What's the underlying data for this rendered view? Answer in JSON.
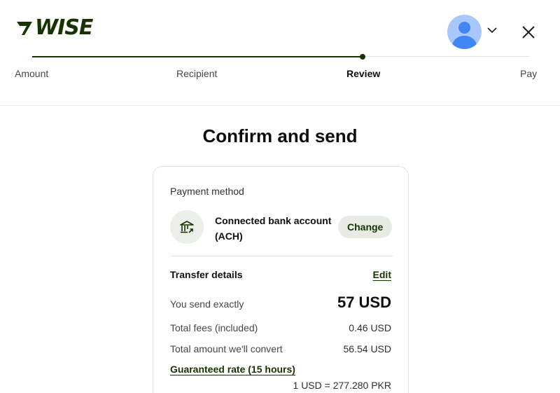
{
  "brand": {
    "logo_text": "WISE",
    "color": "#163300"
  },
  "header": {
    "avatar_icon": "user-avatar-icon",
    "menu_icon": "chevron-down-icon",
    "close_icon": "close-icon"
  },
  "stepper": {
    "steps": [
      {
        "label": "Amount"
      },
      {
        "label": "Recipient"
      },
      {
        "label": "Review"
      },
      {
        "label": "Pay"
      }
    ],
    "active_step": "Review"
  },
  "page": {
    "title": "Confirm and send"
  },
  "payment": {
    "label": "Payment method",
    "icon": "bank-icon",
    "method_line1": "Connected bank account",
    "method_line2": "(ACH)",
    "change_label": "Change"
  },
  "transfer": {
    "label": "Transfer details",
    "edit_label": "Edit",
    "rows": [
      {
        "label": "You send exactly",
        "value": "57 USD"
      },
      {
        "label": "Total fees (included)",
        "value": "0.46 USD"
      },
      {
        "label": "Total amount we'll convert",
        "value": "56.54 USD"
      }
    ],
    "rate_link": "Guaranteed rate (15 hours)",
    "rate_value": "1 USD = 277.280 PKR"
  }
}
